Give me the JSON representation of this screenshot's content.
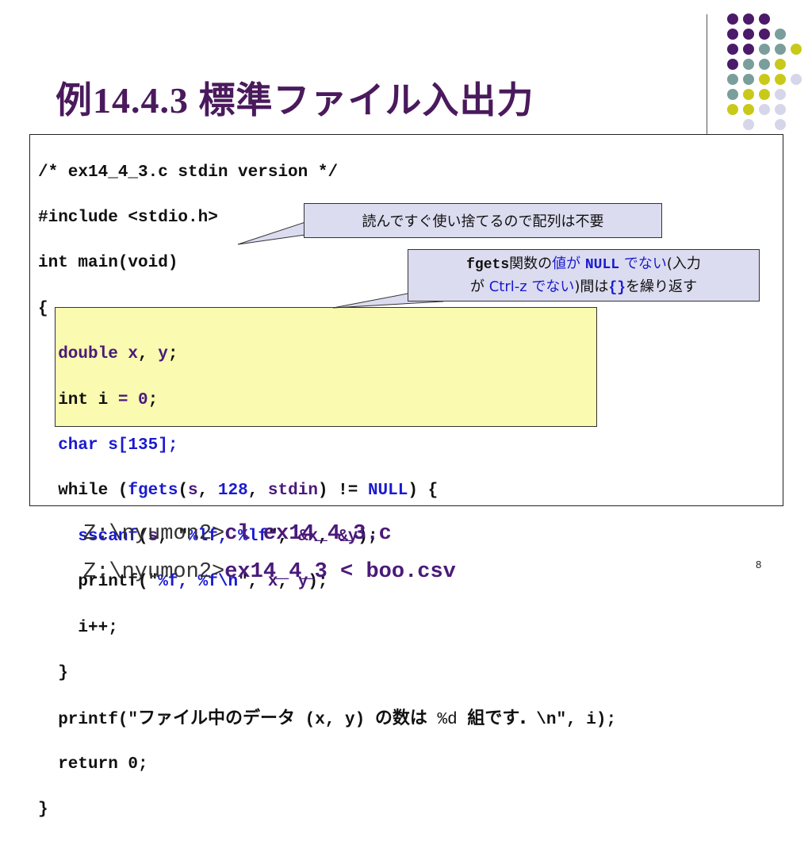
{
  "slide": {
    "title": "例14.4.3 標準ファイル入出力",
    "page_number": "8"
  },
  "code": {
    "line1": "/* ex14_4_3.c stdin version */",
    "line2": "#include <stdio.h>",
    "line3": "int main(void)",
    "line4": "{",
    "line5_a": "  double ",
    "line5_b": "x",
    "line5_c": ", ",
    "line5_d": "y",
    "line5_e": ";",
    "line6_a": "  int i ",
    "line6_b": "=",
    "line6_c": " ",
    "line6_d": "0",
    "line6_e": ";",
    "line7": "  char s[135];",
    "line8_a": "  while (",
    "line8_b": "fgets",
    "line8_c": "(",
    "line8_d": "s",
    "line8_e": ", ",
    "line8_f": "128",
    "line8_g": ", ",
    "line8_h": "stdin",
    "line8_i": ") != ",
    "line8_j": "NULL",
    "line8_k": ") {",
    "line9_a": "    ",
    "line9_b": "sscanf",
    "line9_c": "(",
    "line9_d": "s",
    "line9_e": ", \"",
    "line9_f": "%lf",
    "line9_g": ", ",
    "line9_h": "%lf",
    "line9_i": "\", ",
    "line9_j": "&x",
    "line9_k": ", ",
    "line9_l": "&y",
    "line9_m": ");",
    "line10_a": "    printf(\"",
    "line10_b": "%f, %f\\n",
    "line10_c": "\", ",
    "line10_d": "x",
    "line10_e": ", ",
    "line10_f": "y",
    "line10_g": ");",
    "line11": "    i++;",
    "line12": "  }",
    "line13_a": "  printf(\"",
    "line13_b": "ファイル中のデータ",
    "line13_c": " (x, y) ",
    "line13_d": "の数は",
    "line13_e": " %d ",
    "line13_f": "組です.",
    "line13_g": " \\n\", i);",
    "line14": "  return 0;",
    "line15": "}"
  },
  "callout1": {
    "text": "読んですぐ使い捨てるので配列は不要"
  },
  "callout2": {
    "p1": "fgets",
    "p2": "関数の",
    "p3": "値が ",
    "p4": "NULL",
    "p5": " でない",
    "p6": "(入力",
    "p7": "が ",
    "p8": "Ctrl-z でない",
    "p9": ")間は",
    "p10": "{}",
    "p11": "を繰り返す"
  },
  "commands": {
    "prompt1": "Z:\\nyumon2>",
    "cmd1": "cl ex14_4_3.c",
    "prompt2": "Z:\\nyumon2>",
    "cmd2": "ex14_4_3 < boo.csv"
  },
  "colors": {
    "title": "#4a1a5c",
    "dot_purple": "#4b1a6a",
    "dot_teal": "#7a9e9c",
    "dot_yellow": "#c9c91a",
    "dot_lavender": "#d6d6ea",
    "highlight": "#fafab0",
    "callout_bg": "#dcdcf0"
  }
}
